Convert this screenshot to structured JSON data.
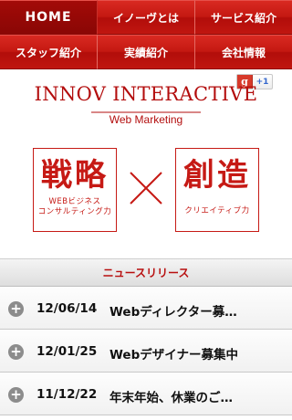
{
  "nav": {
    "items": [
      {
        "label": "HOME",
        "active": true
      },
      {
        "label": "イノーヴとは",
        "active": false
      },
      {
        "label": "サービス紹介",
        "active": false
      },
      {
        "label": "スタッフ紹介",
        "active": false
      },
      {
        "label": "実績紹介",
        "active": false
      },
      {
        "label": "会社情報",
        "active": false
      }
    ]
  },
  "social": {
    "g_label": "g",
    "plus_label": "+1"
  },
  "logo": {
    "title": "INNOV INTERACTIVE",
    "subtitle": "Web Marketing"
  },
  "concepts": {
    "left": {
      "big": "戦略",
      "line1": "WEBビジネス",
      "line2": "コンサルティング力"
    },
    "right": {
      "big": "創造",
      "line1": "クリエイティブ力"
    }
  },
  "news": {
    "header": "ニュースリリース",
    "items": [
      {
        "date": "12/06/14",
        "title": "Webディレクター募…"
      },
      {
        "date": "12/01/25",
        "title": "Webデザイナー募集中"
      },
      {
        "date": "11/12/22",
        "title": "年末年始、休業のご…"
      }
    ]
  },
  "colors": {
    "brand_red": "#c61a15",
    "nav_active": "#960806"
  }
}
